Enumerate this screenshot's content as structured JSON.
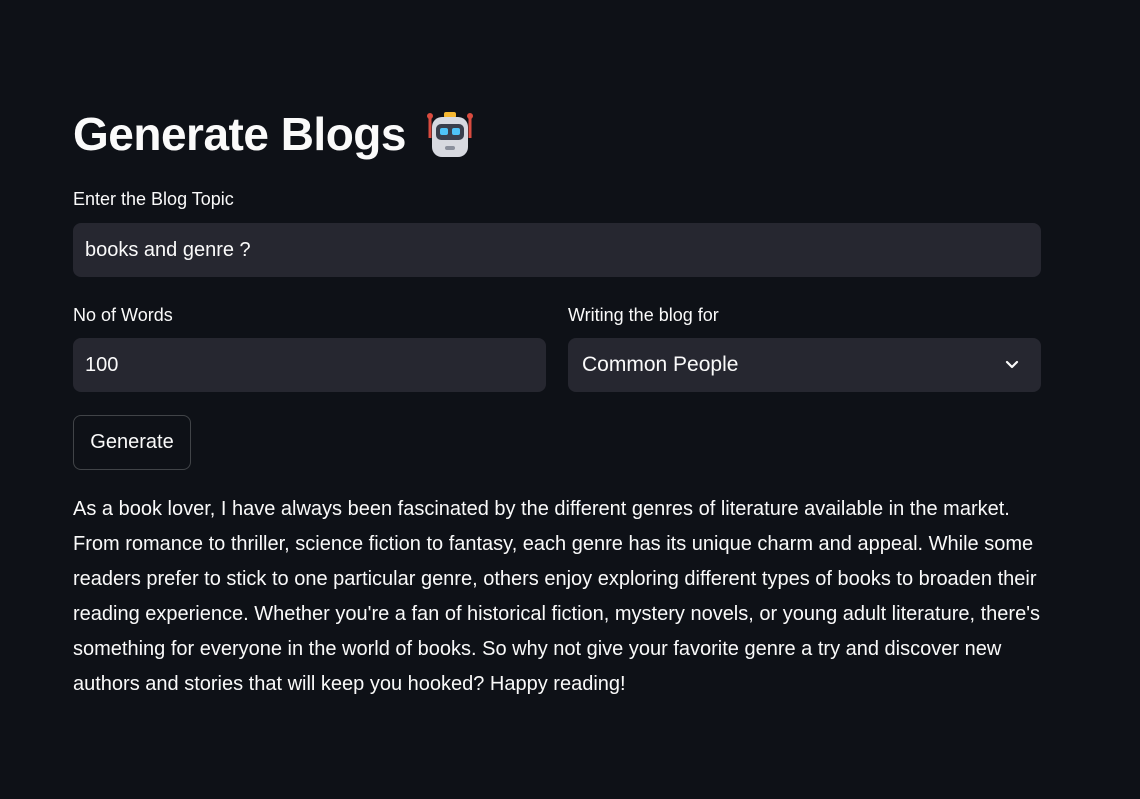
{
  "header": {
    "title": "Generate Blogs",
    "title_icon": "robot-icon"
  },
  "form": {
    "topic_label": "Enter the Blog Topic",
    "topic_value": "books and genre ?",
    "words_label": "No of Words",
    "words_value": "100",
    "audience_label": "Writing the blog for",
    "audience_selected": "Common People",
    "generate_label": "Generate"
  },
  "output": {
    "blog_text": "As a book lover, I have always been fascinated by the different genres of literature available in the market. From romance to thriller, science fiction to fantasy, each genre has its unique charm and appeal. While some readers prefer to stick to one particular genre, others enjoy exploring different types of books to broaden their reading experience. Whether you're a fan of historical fiction, mystery novels, or young adult literature, there's something for everyone in the world of books. So why not give your favorite genre a try and discover new authors and stories that will keep you hooked? Happy reading!"
  },
  "colors": {
    "background": "#0e1117",
    "input_background": "#262730",
    "text": "#fafafa"
  }
}
